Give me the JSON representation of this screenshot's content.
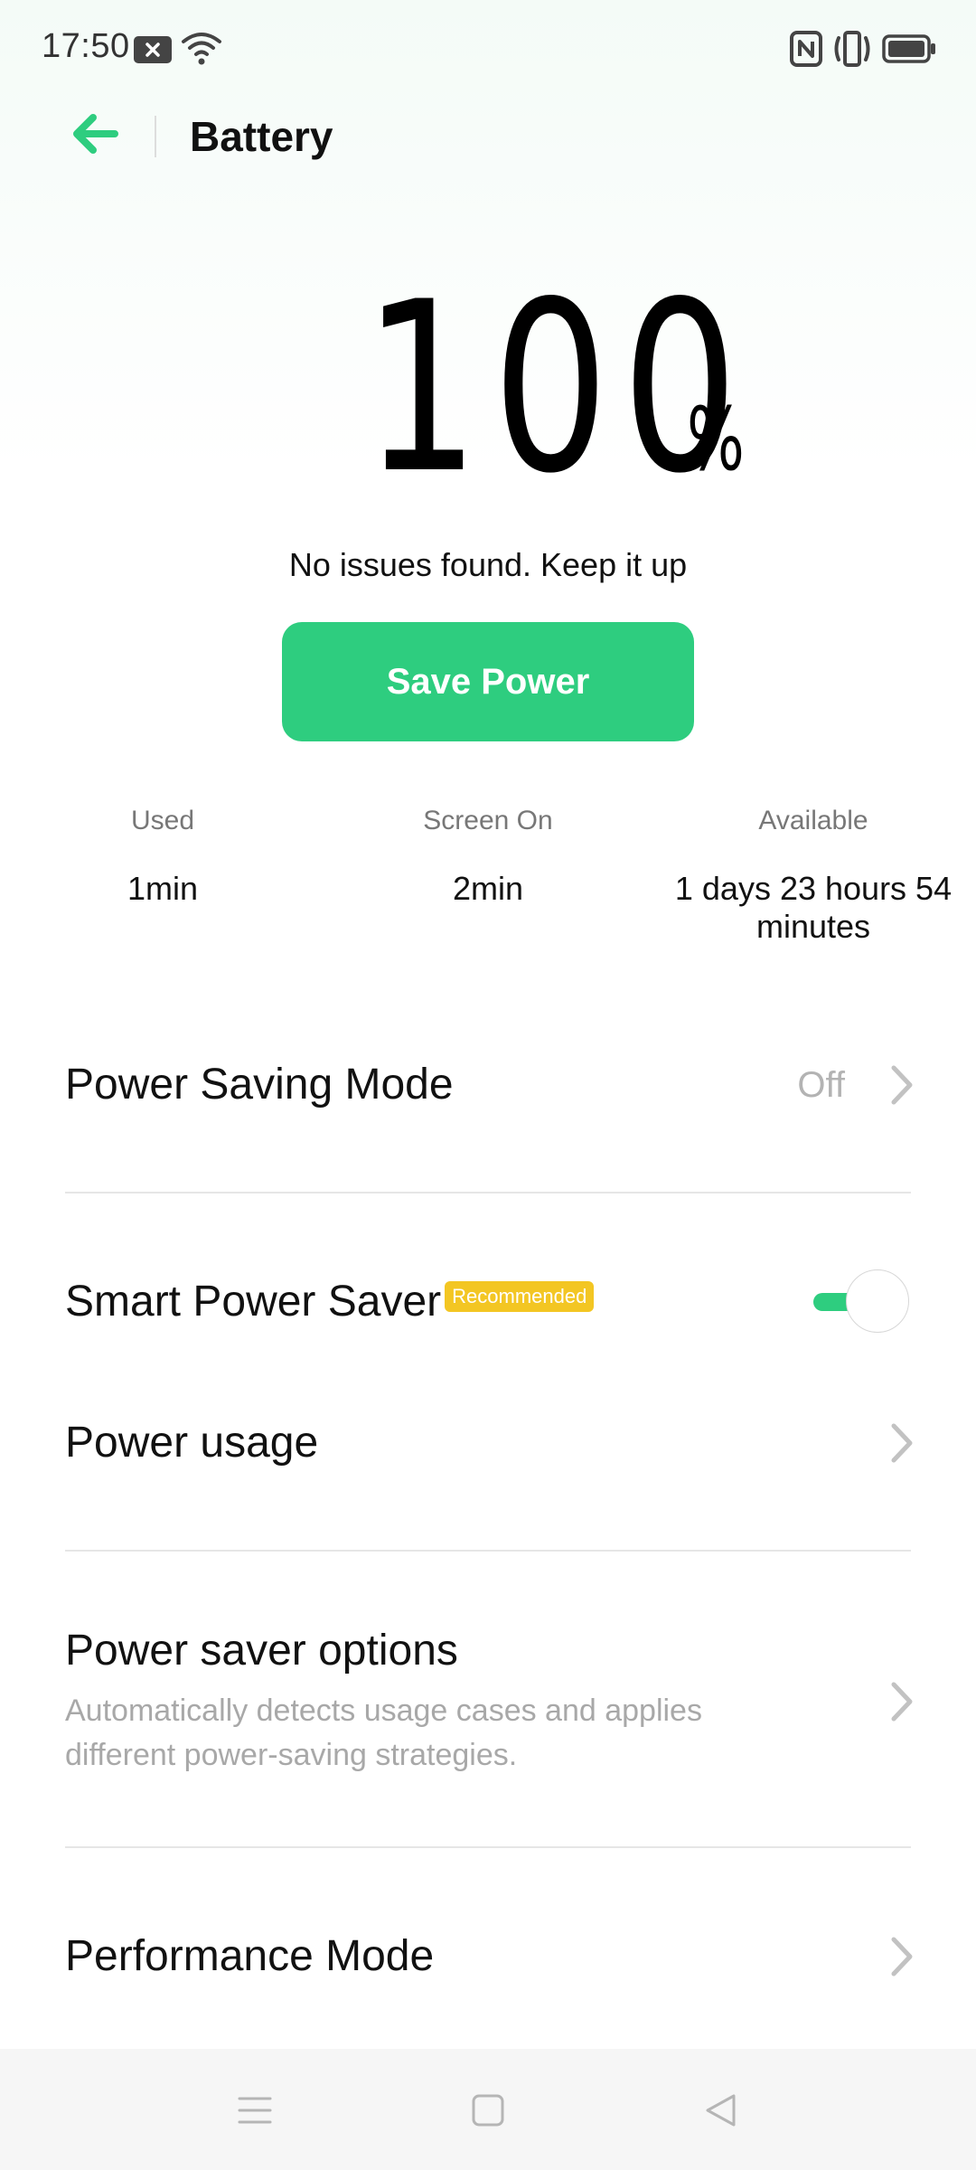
{
  "status_bar": {
    "time": "17:50",
    "left_icons": [
      "notification-x-icon",
      "wifi-icon"
    ],
    "right_icons": [
      "nfc-icon",
      "vibrate-icon",
      "battery-full-icon"
    ]
  },
  "header": {
    "back_icon": "arrow-left-icon",
    "title": "Battery"
  },
  "battery": {
    "level": "100",
    "unit": "%",
    "status_message": "No issues found. Keep it up",
    "save_power_label": "Save Power"
  },
  "stats": [
    {
      "label": "Used",
      "value": "1min"
    },
    {
      "label": "Screen On",
      "value": "2min"
    },
    {
      "label": "Available",
      "value": "1 days 23 hours 54 minutes"
    }
  ],
  "settings": {
    "power_saving_mode": {
      "title": "Power Saving Mode",
      "value": "Off"
    },
    "smart_power_saver": {
      "title": "Smart Power Saver",
      "badge": "Recommended",
      "enabled": true
    },
    "power_usage": {
      "title": "Power usage"
    },
    "power_saver_options": {
      "title": "Power saver options",
      "subtitle": "Automatically detects usage cases and applies different power-saving strategies."
    },
    "performance_mode": {
      "title": "Performance Mode"
    }
  },
  "nav_bar": {
    "icons": [
      "menu-icon",
      "home-icon",
      "back-triangle-icon"
    ]
  },
  "colors": {
    "accent": "#2ecd7f",
    "badge": "#f3c623",
    "secondary_text": "#a8a8a8"
  }
}
